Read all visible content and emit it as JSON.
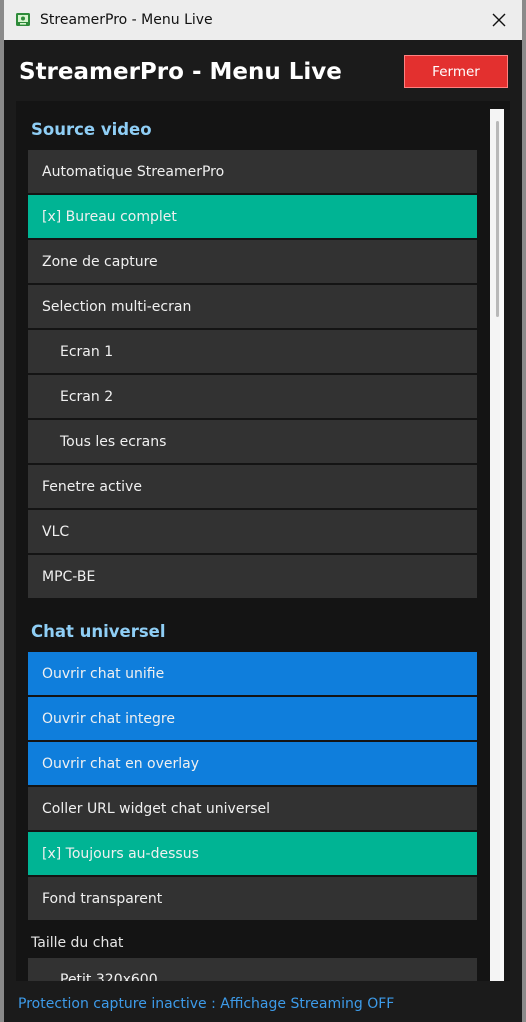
{
  "window": {
    "title": "StreamerPro - Menu Live"
  },
  "header": {
    "title": "StreamerPro - Menu Live",
    "close_button": "Fermer"
  },
  "colors": {
    "accent_checked": "#00b494",
    "accent_blue": "#0f7edc",
    "danger": "#e3302f",
    "section_title": "#8fcef5",
    "status_text": "#3d9be9"
  },
  "source_video": {
    "title": "Source video",
    "items": [
      {
        "label": "Automatique StreamerPro"
      },
      {
        "label": "[x] Bureau complet"
      },
      {
        "label": "Zone de capture"
      },
      {
        "label": "Selection multi-ecran"
      },
      {
        "label": "Ecran 1"
      },
      {
        "label": "Ecran 2"
      },
      {
        "label": "Tous les ecrans"
      },
      {
        "label": "Fenetre active"
      },
      {
        "label": "VLC"
      },
      {
        "label": "MPC-BE"
      }
    ]
  },
  "chat": {
    "title": "Chat universel",
    "items": [
      {
        "label": "Ouvrir chat unifie"
      },
      {
        "label": "Ouvrir chat integre"
      },
      {
        "label": "Ouvrir chat en overlay"
      },
      {
        "label": "Coller URL widget chat universel"
      },
      {
        "label": "[x] Toujours au-dessus"
      },
      {
        "label": "Fond transparent"
      }
    ],
    "size_label": "Taille du chat",
    "size_items": [
      {
        "label": "Petit 320x600"
      }
    ]
  },
  "status": {
    "text": "Protection capture inactive : Affichage Streaming OFF"
  }
}
